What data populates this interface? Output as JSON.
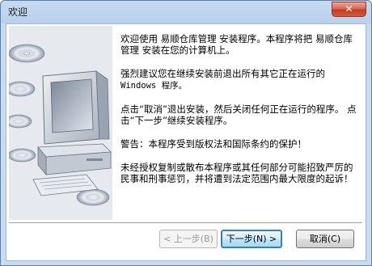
{
  "window": {
    "title": "欢迎",
    "close_label": "✕"
  },
  "icons": {
    "art": "computer-cd-illustration",
    "close": "close-icon"
  },
  "message": {
    "p1": "欢迎使用 易顺仓库管理 安装程序。本程序将把 易顺仓库管理 安装在您的计算机上。",
    "p2a": "强烈建议您在继续安装前退出所有其它正在运行的",
    "p2b": "Windows 程序。",
    "p3": "点击“取消”退出安装，然后关闭任何正在运行的程序。 点击“下一步”继续安装程序。",
    "p4": "警告：本程序受到版权法和国际条约的保护！",
    "p5": "未经授权复制或散布本程序或其任何部分可能招致严厉的民事和刑事惩罚，并将遭到法定范围内最大限度的起诉！"
  },
  "buttons": {
    "back": "< 上一步(B)",
    "next": "下一步(N) >",
    "cancel": "取消(C)"
  },
  "colors": {
    "title_bar": "#c6dbf1",
    "close": "#c43b22",
    "default_border": "#3c7fb1"
  }
}
